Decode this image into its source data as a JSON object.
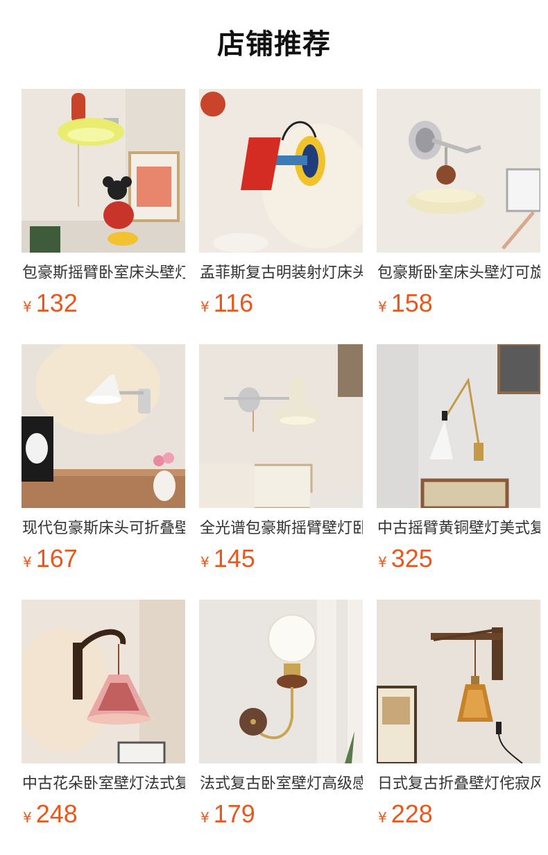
{
  "header": {
    "title": "店铺推荐"
  },
  "currency_symbol": "¥",
  "colors": {
    "price": "#e8581e"
  },
  "products": [
    {
      "name": "包豪斯摇臂卧室床头壁灯",
      "price": "132",
      "image_icon": "bauhaus-swing-arm-wall-lamp-image"
    },
    {
      "name": "孟菲斯复古明装射灯床头灯",
      "price": "116",
      "image_icon": "memphis-spotlight-wall-lamp-image"
    },
    {
      "name": "包豪斯卧室床头壁灯可旋转",
      "price": "158",
      "image_icon": "bauhaus-swivel-wall-lamp-image"
    },
    {
      "name": "现代包豪斯床头可折叠壁灯",
      "price": "167",
      "image_icon": "modern-folding-arm-wall-lamp-image"
    },
    {
      "name": "全光谱包豪斯摇臂壁灯卧室",
      "price": "145",
      "image_icon": "full-spectrum-swing-wall-lamp-image"
    },
    {
      "name": "中古摇臂黄铜壁灯美式复古",
      "price": "325",
      "image_icon": "vintage-brass-swing-wall-lamp-image"
    },
    {
      "name": "中古花朵卧室壁灯法式复古",
      "price": "248",
      "image_icon": "vintage-flower-glass-wall-lamp-image"
    },
    {
      "name": "法式复古卧室壁灯高级感",
      "price": "179",
      "image_icon": "french-globe-wall-lamp-image"
    },
    {
      "name": "日式复古折叠壁灯侘寂风",
      "price": "228",
      "image_icon": "japanese-folding-wood-wall-lamp-image"
    }
  ]
}
